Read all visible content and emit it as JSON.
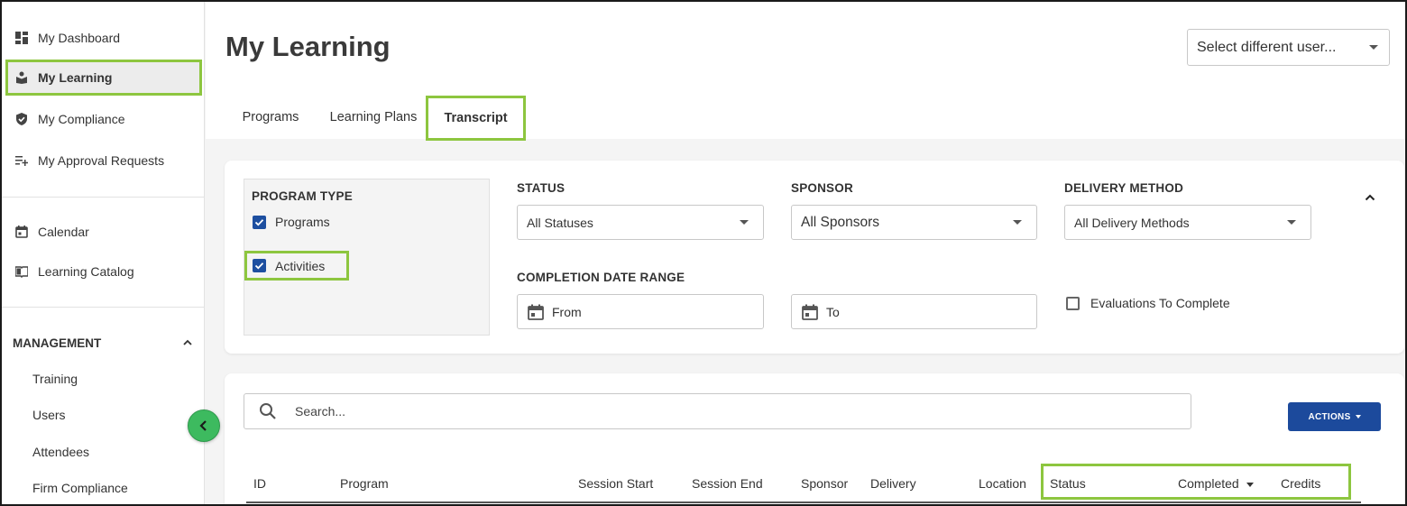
{
  "sidebar": {
    "primary": [
      {
        "label": "My Dashboard",
        "icon": "dashboard-icon"
      },
      {
        "label": "My Learning",
        "icon": "learning-icon"
      },
      {
        "label": "My Compliance",
        "icon": "shield-icon"
      },
      {
        "label": "My Approval Requests",
        "icon": "playlist-add-icon"
      }
    ],
    "secondary": [
      {
        "label": "Calendar",
        "icon": "calendar-icon"
      },
      {
        "label": "Learning Catalog",
        "icon": "book-icon"
      }
    ],
    "management": {
      "title": "MANAGEMENT",
      "items": [
        "Training",
        "Users",
        "Attendees",
        "Firm Compliance"
      ]
    }
  },
  "header": {
    "title": "My Learning",
    "user_select": "Select different user..."
  },
  "tabs": [
    {
      "label": "Programs",
      "active": false
    },
    {
      "label": "Learning Plans",
      "active": false
    },
    {
      "label": "Transcript",
      "active": true
    }
  ],
  "filters": {
    "program_type": {
      "label": "PROGRAM TYPE",
      "options": [
        {
          "label": "Programs",
          "checked": true
        },
        {
          "label": "Activities",
          "checked": true
        }
      ]
    },
    "status": {
      "label": "STATUS",
      "value": "All Statuses"
    },
    "sponsor": {
      "label": "SPONSOR",
      "value": "All Sponsors"
    },
    "delivery_method": {
      "label": "DELIVERY METHOD",
      "value": "All Delivery Methods"
    },
    "completion_date_range": {
      "label": "COMPLETION DATE RANGE",
      "from": "From",
      "to": "To"
    },
    "evaluations": {
      "label": "Evaluations To Complete",
      "checked": false
    }
  },
  "results": {
    "search_placeholder": "Search...",
    "actions_label": "ACTIONS",
    "columns": [
      "ID",
      "Program",
      "Session Start",
      "Session End",
      "Sponsor",
      "Delivery",
      "Location",
      "Status",
      "Completed",
      "Credits"
    ]
  },
  "colors": {
    "accent_blue": "#1c4a9c",
    "highlight_green": "#8dc63f",
    "collapse_green": "#3dba5f"
  }
}
